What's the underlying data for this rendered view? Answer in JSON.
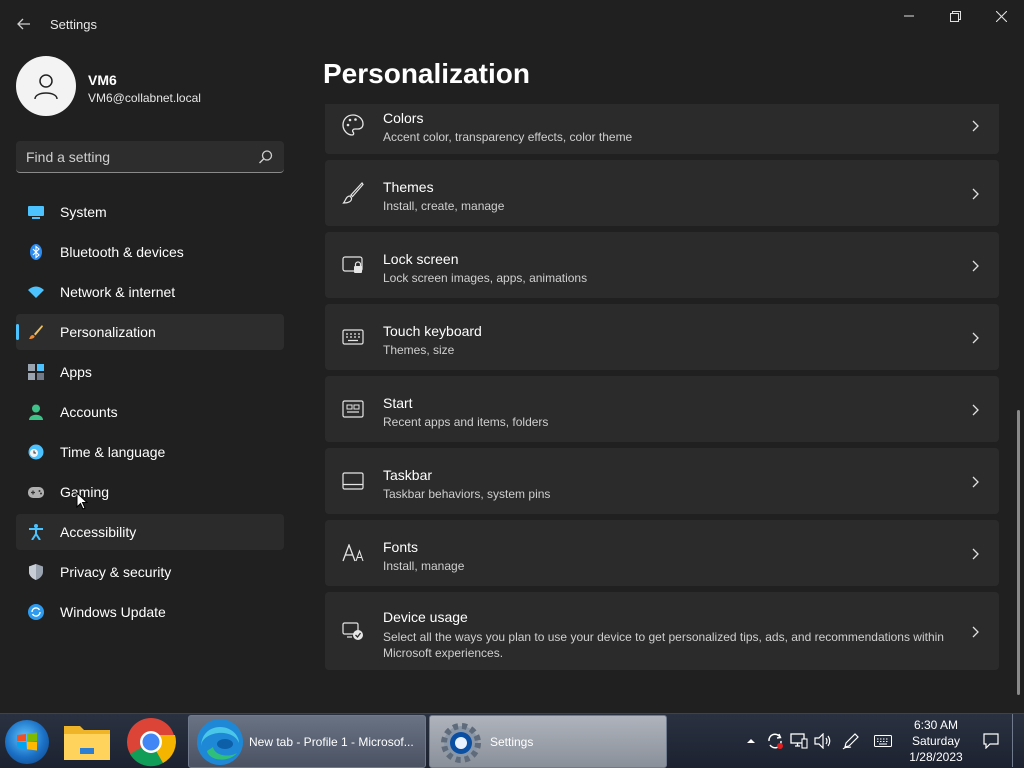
{
  "window": {
    "title": "Settings",
    "back_icon": "back-arrow-icon",
    "controls": [
      "minimize-icon",
      "maximize-icon",
      "close-icon"
    ]
  },
  "profile": {
    "name": "VM6",
    "email": "VM6@collabnet.local"
  },
  "search": {
    "placeholder": "Find a setting"
  },
  "nav": {
    "items": [
      {
        "label": "System",
        "icon": "system-icon",
        "color": "#4cc2ff"
      },
      {
        "label": "Bluetooth & devices",
        "icon": "bluetooth-icon",
        "color": "#2d8cf0"
      },
      {
        "label": "Network & internet",
        "icon": "wifi-icon",
        "color": "#4cc2ff"
      },
      {
        "label": "Personalization",
        "icon": "brush-icon",
        "color": "#f0a030"
      },
      {
        "label": "Apps",
        "icon": "apps-icon",
        "color": "#9aa3b0"
      },
      {
        "label": "Accounts",
        "icon": "accounts-icon",
        "color": "#3fc28a"
      },
      {
        "label": "Time & language",
        "icon": "time-language-icon",
        "color": "#4cc2ff"
      },
      {
        "label": "Gaming",
        "icon": "gaming-icon",
        "color": "#b0b0b0"
      },
      {
        "label": "Accessibility",
        "icon": "accessibility-icon",
        "color": "#4cc2ff"
      },
      {
        "label": "Privacy & security",
        "icon": "shield-icon",
        "color": "#9aa3b0"
      },
      {
        "label": "Windows Update",
        "icon": "windows-update-icon",
        "color": "#2d9cf0"
      }
    ],
    "active_index": 3,
    "accent": "#4cc2ff"
  },
  "main": {
    "title": "Personalization",
    "cards": [
      {
        "title": "Colors",
        "subtitle": "Accent color, transparency effects, color theme",
        "icon": "palette-icon"
      },
      {
        "title": "Themes",
        "subtitle": "Install, create, manage",
        "icon": "brush-icon"
      },
      {
        "title": "Lock screen",
        "subtitle": "Lock screen images, apps, animations",
        "icon": "lock-screen-icon"
      },
      {
        "title": "Touch keyboard",
        "subtitle": "Themes, size",
        "icon": "keyboard-icon"
      },
      {
        "title": "Start",
        "subtitle": "Recent apps and items, folders",
        "icon": "start-menu-icon"
      },
      {
        "title": "Taskbar",
        "subtitle": "Taskbar behaviors, system pins",
        "icon": "taskbar-icon"
      },
      {
        "title": "Fonts",
        "subtitle": "Install, manage",
        "icon": "fonts-icon"
      },
      {
        "title": "Device usage",
        "subtitle": "Select all the ways you plan to use your device to get personalized tips, ads, and recommendations within Microsoft experiences.",
        "icon": "device-usage-icon"
      }
    ]
  },
  "taskbar": {
    "start_icon": "windows-start-icon",
    "pinned": [
      "file-explorer-icon",
      "chrome-icon"
    ],
    "tasks": [
      {
        "label": "New tab - Profile 1 - Microsof...",
        "icon": "edge-icon"
      },
      {
        "label": "Settings",
        "icon": "settings-gear-icon"
      }
    ],
    "tray": [
      "show-hidden-icons-icon",
      "sync-icon",
      "display-icon",
      "volume-icon",
      "pen-icon",
      "keyboard-icon"
    ],
    "clock": {
      "time": "6:30 AM",
      "day": "Saturday",
      "date": "1/28/2023"
    },
    "notification_icon": "action-center-icon"
  }
}
